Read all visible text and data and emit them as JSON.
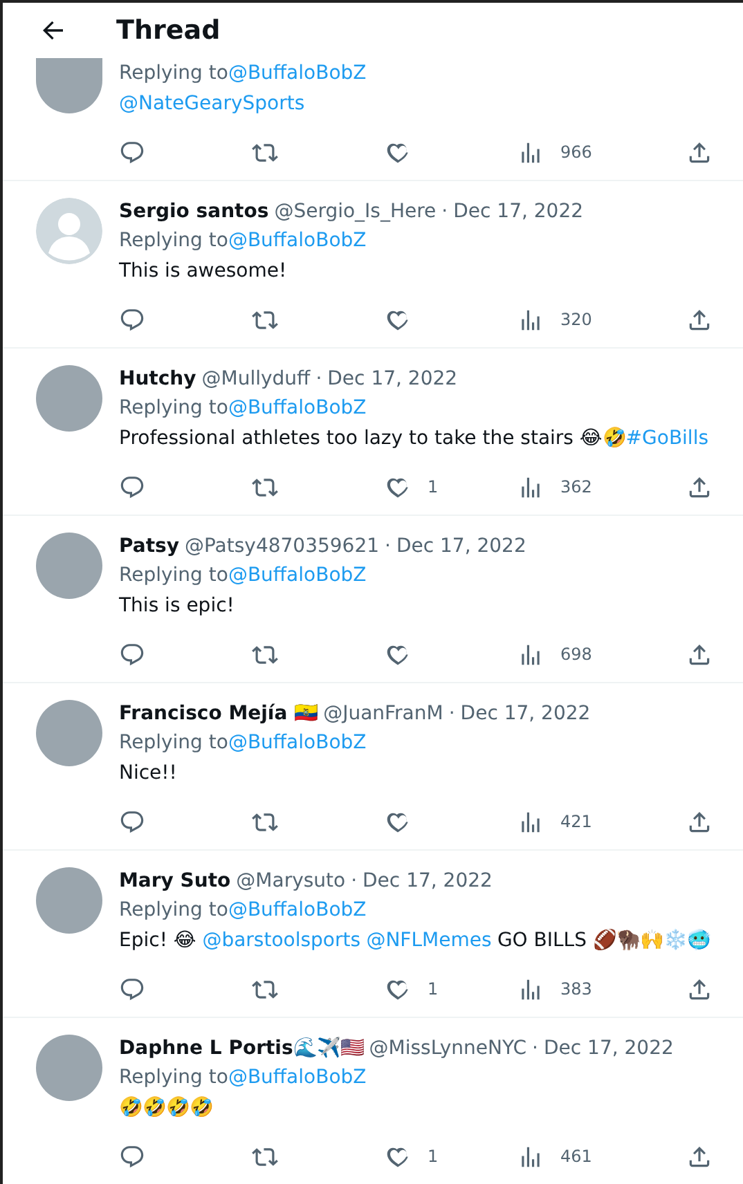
{
  "header": {
    "title": "Thread"
  },
  "tweets": [
    {
      "kind": "photo",
      "replying_label": "Replying to",
      "replying_to": "@BuffaloBobZ",
      "body": [
        {
          "kind": "link",
          "text": "@NateGearySports"
        }
      ],
      "views": "966"
    },
    {
      "kind": "default",
      "name": "Sergio santos",
      "handle": "@Sergio_Is_Here",
      "separator": "·",
      "date": "Dec 17, 2022",
      "replying_label": "Replying to",
      "replying_to": "@BuffaloBobZ",
      "body": [
        {
          "kind": "text",
          "text": "This is awesome!"
        }
      ],
      "views": "320"
    },
    {
      "kind": "photo",
      "name": "Hutchy",
      "handle": "@Mullyduff",
      "separator": "·",
      "date": "Dec 17, 2022",
      "replying_label": "Replying to",
      "replying_to": "@BuffaloBobZ",
      "body": [
        {
          "kind": "text",
          "text": "Professional athletes too lazy to take the stairs 😂🤣"
        },
        {
          "kind": "link",
          "text": "#GoBills"
        }
      ],
      "likes": "1",
      "views": "362"
    },
    {
      "kind": "photo",
      "name": "Patsy",
      "handle": "@Patsy4870359621",
      "separator": "·",
      "date": "Dec 17, 2022",
      "replying_label": "Replying to",
      "replying_to": "@BuffaloBobZ",
      "body": [
        {
          "kind": "text",
          "text": "This is epic!"
        }
      ],
      "views": "698"
    },
    {
      "kind": "photo",
      "name": "Francisco Mejía 🇪🇨",
      "handle": "@JuanFranM",
      "separator": "·",
      "date": "Dec 17, 2022",
      "replying_label": "Replying to",
      "replying_to": "@BuffaloBobZ",
      "body": [
        {
          "kind": "text",
          "text": "Nice!!"
        }
      ],
      "views": "421"
    },
    {
      "kind": "photo",
      "name": "Mary Suto",
      "handle": "@Marysuto",
      "separator": "·",
      "date": "Dec 17, 2022",
      "replying_label": "Replying to",
      "replying_to": "@BuffaloBobZ",
      "body": [
        {
          "kind": "text",
          "text": "Epic! 😂 "
        },
        {
          "kind": "link",
          "text": "@barstoolsports"
        },
        {
          "kind": "link",
          "text": "@NFLMemes"
        },
        {
          "kind": "text",
          "text": "GO BILLS 🏈🦬🙌❄️🥶"
        }
      ],
      "likes": "1",
      "views": "383"
    },
    {
      "kind": "photo",
      "name": "Daphne L Portis🌊✈️🇺🇸",
      "handle": "@MissLynneNYC",
      "separator": "·",
      "date": "Dec 17, 2022",
      "replying_label": "Replying to",
      "replying_to": "@BuffaloBobZ",
      "body": [
        {
          "kind": "text",
          "text": "🤣🤣🤣🤣"
        }
      ],
      "likes": "1",
      "views": "461"
    }
  ]
}
